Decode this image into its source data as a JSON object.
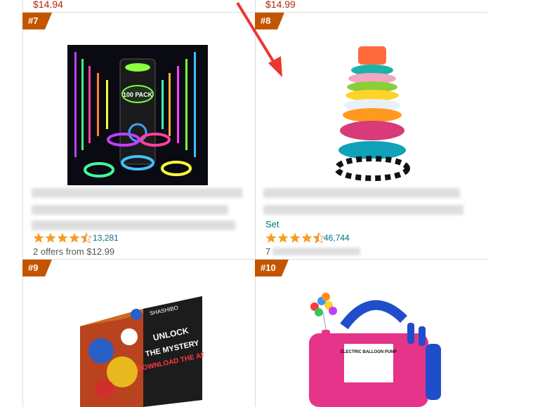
{
  "top_prices": [
    "$14.94",
    "$14.99"
  ],
  "products": [
    {
      "rank": "#7",
      "title_partial": "",
      "offers": "2 offers from $12.99",
      "rating_count": "13,281",
      "rating": 4.5,
      "image": "glow-sticks-pack",
      "image_text": "100 PACK"
    },
    {
      "rank": "#8",
      "title_partial": "Set",
      "offers": "7",
      "rating_count": "46,744",
      "rating": 4.5,
      "image": "stacking-rings-toy"
    },
    {
      "rank": "#9",
      "image": "shashibo-magnetic-cube",
      "image_text_lines": [
        "UNLOCK",
        "THE MYSTERY",
        "DOWNLOAD THE APP"
      ],
      "brand_text": "SHASHIBO"
    },
    {
      "rank": "#10",
      "image": "electric-balloon-pump",
      "image_text": "ELECTRIC BALLOON PUMP"
    }
  ],
  "colors": {
    "badge": "#c45500",
    "price": "#b12704",
    "link": "#007185",
    "star": "#f69c1f",
    "pointer_arrow": "#e8372e"
  }
}
